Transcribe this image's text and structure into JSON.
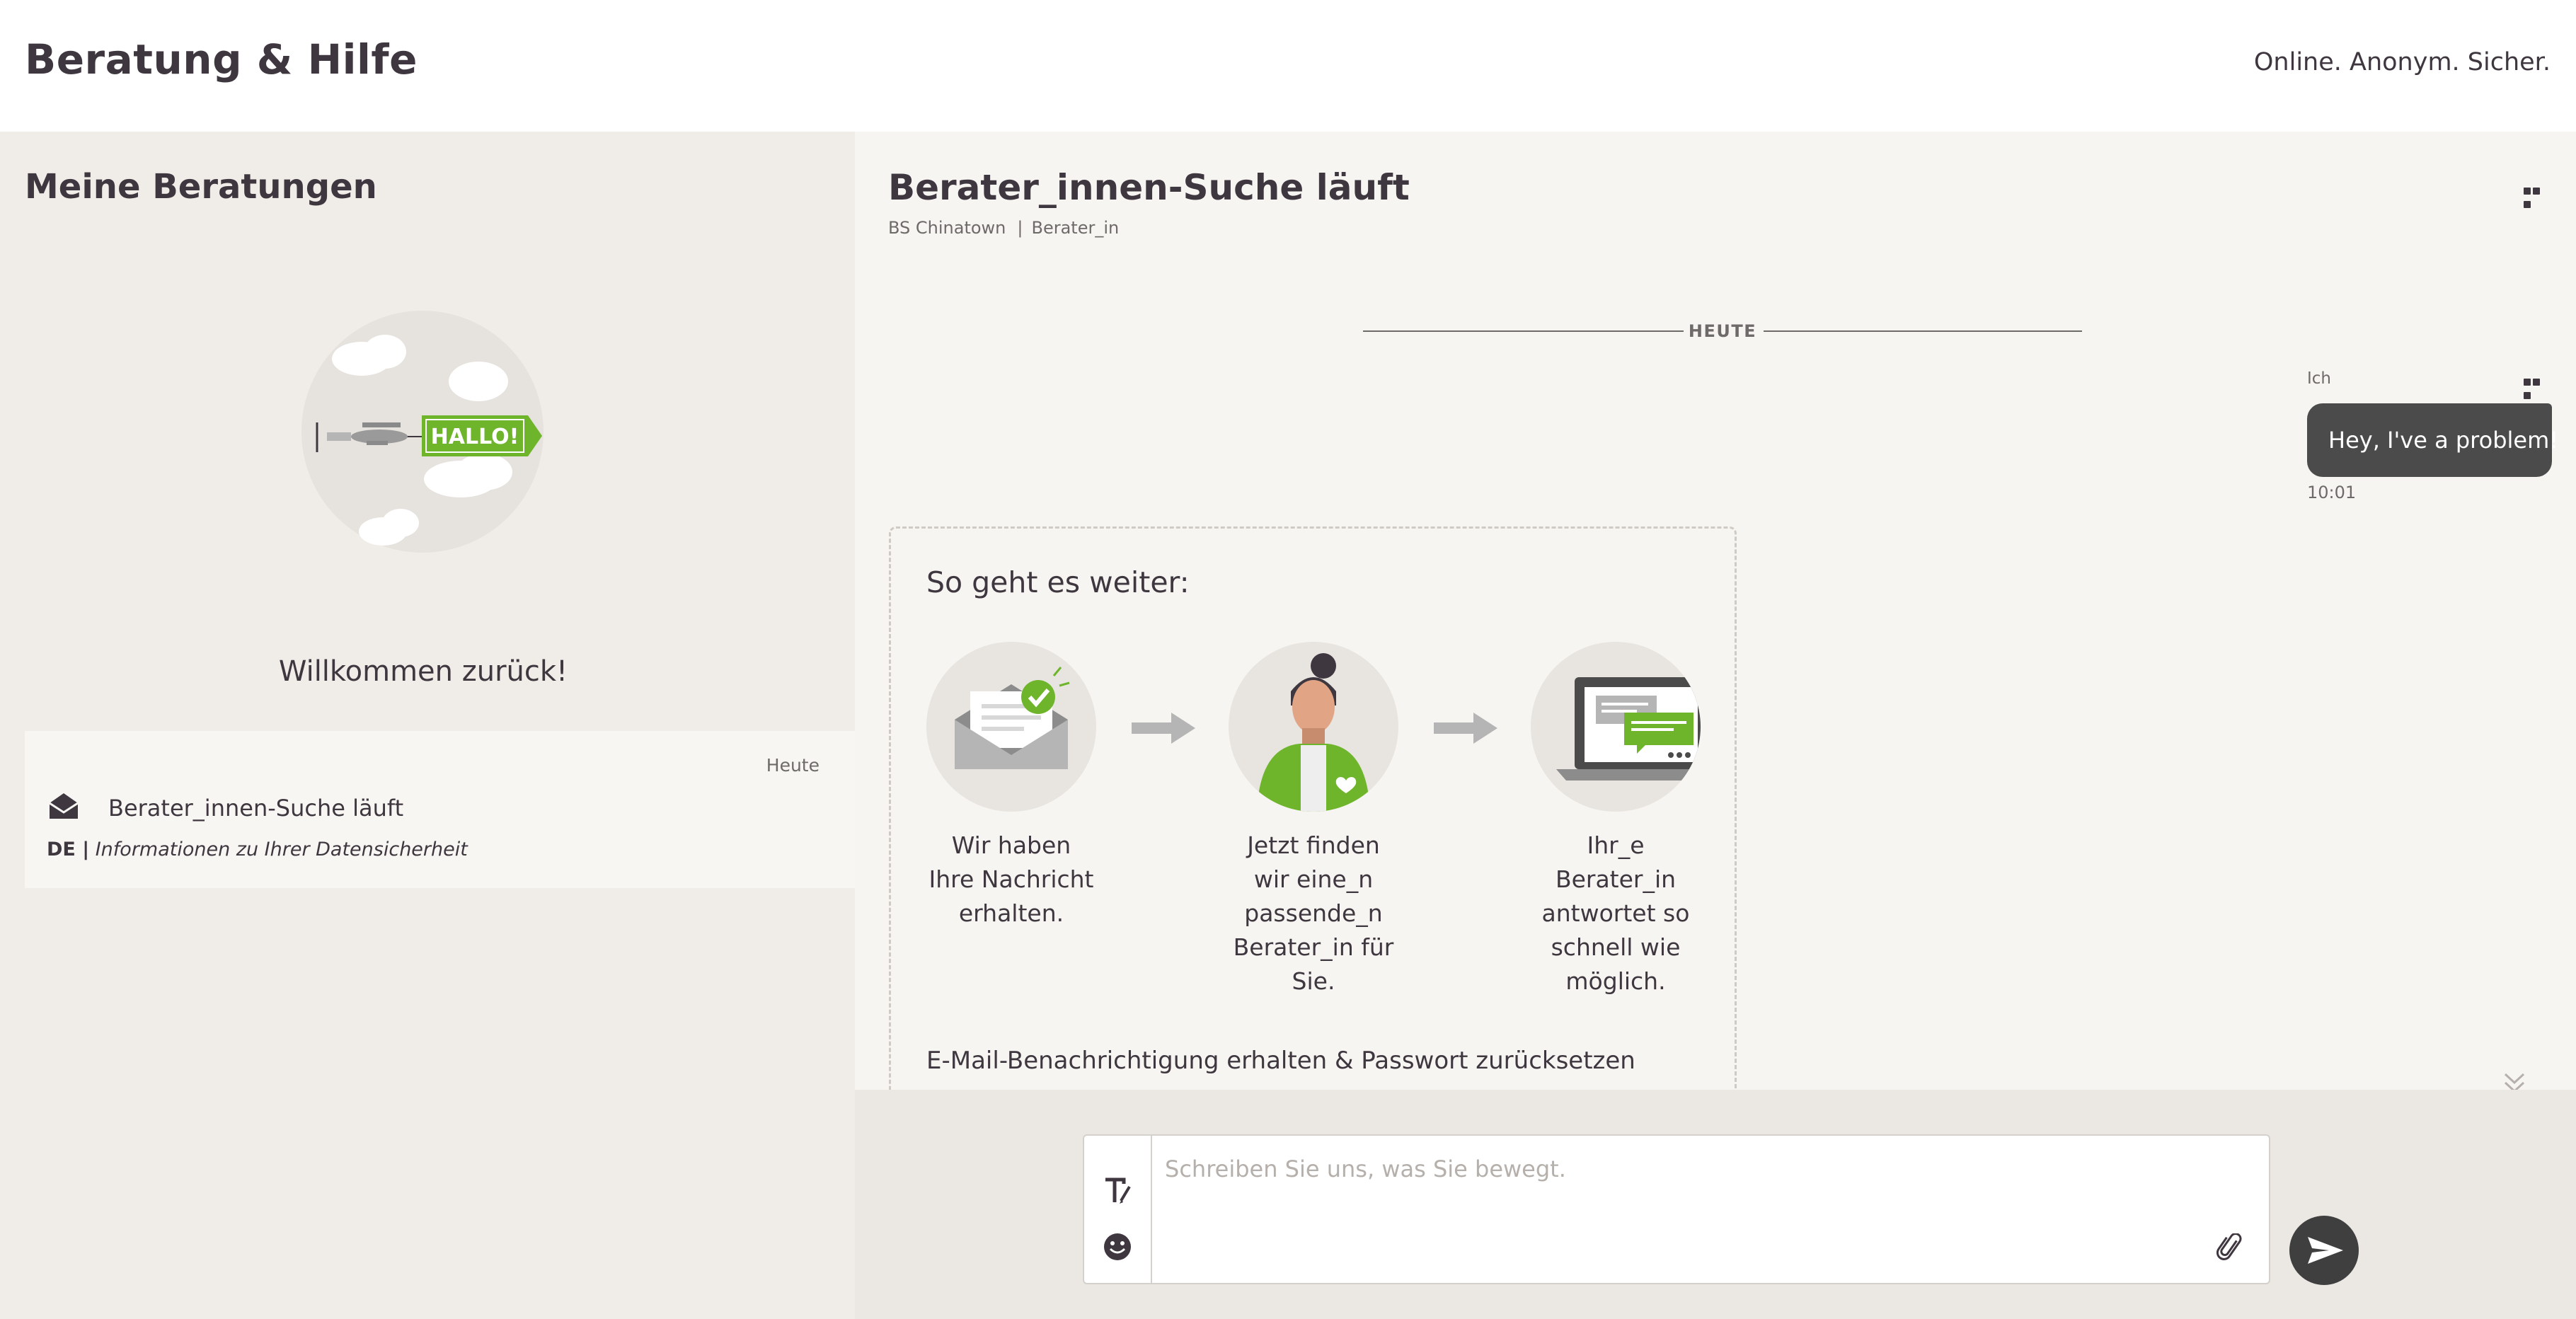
{
  "header": {
    "title": "Beratung & Hilfe",
    "claim": "Online. Anonym. Sicher."
  },
  "sidebar": {
    "title": "Meine Beratungen",
    "illustration_text": "HALLO!",
    "welcome": "Willkommen zurück!",
    "sessions": [
      {
        "date": "Heute",
        "icon": "envelope-open-icon",
        "title": "Berater_innen-Suche läuft",
        "language": "DE |",
        "subject": "Informationen zu Ihrer Datensicherheit"
      }
    ]
  },
  "chat": {
    "title": "Berater_innen-Suche läuft",
    "agency": "BS Chinatown",
    "separator": "|",
    "role": "Berater_in",
    "day_divider": "HEUTE",
    "messages": [
      {
        "sender": "Ich",
        "text": "Hey, I've a problem!",
        "time": "10:01"
      }
    ],
    "info_card": {
      "title": "So geht es weiter:",
      "steps": [
        {
          "icon": "envelope-check-icon",
          "text": "Wir haben Ihre Nachricht erhalten."
        },
        {
          "icon": "counselor-icon",
          "text": "Jetzt finden wir eine_n passende_n Berater_in für Sie."
        },
        {
          "icon": "laptop-chat-icon",
          "text": "Ihr_e Berater_in antwortet so schnell wie möglich."
        }
      ],
      "footer": "E-Mail-Benachrichtigung erhalten & Passwort zurücksetzen"
    }
  },
  "composer": {
    "placeholder": "Schreiben Sie uns, was Sie bewegt."
  },
  "colors": {
    "accent_green": "#6fb52c",
    "dark_bubble": "#4c4b4b",
    "sidebar_bg": "#f0ece7",
    "main_bg": "#f7f5f2"
  }
}
